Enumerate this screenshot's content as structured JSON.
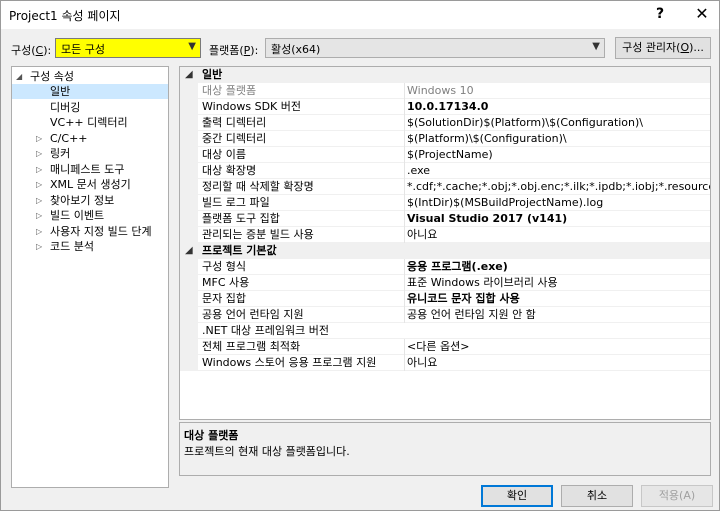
{
  "window": {
    "title": "Project1 속성 페이지",
    "help_glyph": "?",
    "close_glyph": "✕"
  },
  "toolbar": {
    "config_label": "구성(",
    "config_accel": "C",
    "config_label_end": "):",
    "config_value": "모든 구성",
    "platform_label": "플랫폼(",
    "platform_accel": "P",
    "platform_label_end": "):",
    "platform_value": "활성(x64)",
    "config_manager_label": "구성 관리자(",
    "config_manager_accel": "O",
    "config_manager_end": ")..."
  },
  "tree": {
    "root": "구성 속성",
    "items": [
      {
        "label": "일반",
        "selected": true,
        "expandable": false
      },
      {
        "label": "디버깅",
        "expandable": false
      },
      {
        "label": "VC++ 디렉터리",
        "expandable": false
      },
      {
        "label": "C/C++",
        "expandable": true
      },
      {
        "label": "링커",
        "expandable": true
      },
      {
        "label": "매니페스트 도구",
        "expandable": true
      },
      {
        "label": "XML 문서 생성기",
        "expandable": true
      },
      {
        "label": "찾아보기 정보",
        "expandable": true
      },
      {
        "label": "빌드 이벤트",
        "expandable": true
      },
      {
        "label": "사용자 지정 빌드 단계",
        "expandable": true
      },
      {
        "label": "코드 분석",
        "expandable": true
      }
    ]
  },
  "grid": {
    "sections": [
      {
        "title": "일반",
        "rows": [
          {
            "name": "대상 플랫폼",
            "value": "Windows 10",
            "gray": true
          },
          {
            "name": "Windows SDK 버전",
            "value": "10.0.17134.0",
            "bold": true
          },
          {
            "name": "출력 디렉터리",
            "value": "$(SolutionDir)$(Platform)\\$(Configuration)\\"
          },
          {
            "name": "중간 디렉터리",
            "value": "$(Platform)\\$(Configuration)\\"
          },
          {
            "name": "대상 이름",
            "value": "$(ProjectName)"
          },
          {
            "name": "대상 확장명",
            "value": ".exe"
          },
          {
            "name": "정리할 때 삭제할 확장명",
            "value": "*.cdf;*.cache;*.obj;*.obj.enc;*.ilk;*.ipdb;*.iobj;*.resources;*.tlb;*.tli;*.tl"
          },
          {
            "name": "빌드 로그 파일",
            "value": "$(IntDir)$(MSBuildProjectName).log"
          },
          {
            "name": "플랫폼 도구 집합",
            "value": "Visual Studio 2017 (v141)",
            "bold": true
          },
          {
            "name": "관리되는 증분 빌드 사용",
            "value": "아니요"
          }
        ]
      },
      {
        "title": "프로젝트 기본값",
        "rows": [
          {
            "name": "구성 형식",
            "value": "응용 프로그램(.exe)",
            "bold": true
          },
          {
            "name": "MFC 사용",
            "value": "표준 Windows 라이브러리 사용"
          },
          {
            "name": "문자 집합",
            "value": "유니코드 문자 집합 사용",
            "bold": true
          },
          {
            "name": "공용 언어 런타임 지원",
            "value": "공용 언어 런타임 지원 안 함"
          },
          {
            "name": ".NET 대상 프레임워크 버전",
            "value": ""
          },
          {
            "name": "전체 프로그램 최적화",
            "value": "<다른 옵션>"
          },
          {
            "name": "Windows 스토어 응용 프로그램 지원",
            "value": "아니요"
          }
        ]
      }
    ]
  },
  "description": {
    "title": "대상 플랫폼",
    "text": "프로젝트의 현재 대상 플랫폼입니다."
  },
  "footer": {
    "ok": "확인",
    "cancel": "취소",
    "apply": "적용(A)"
  },
  "colors": {
    "highlight": "#ffff00",
    "selection": "#cce8ff",
    "accent": "#0078d7"
  }
}
